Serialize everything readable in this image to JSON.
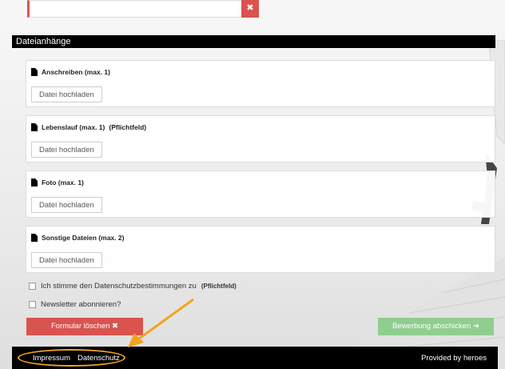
{
  "section": {
    "title": "Dateianhänge"
  },
  "attachments": [
    {
      "label": "Anschreiben (max. 1)",
      "button": "Datei hochladen"
    },
    {
      "label": "Lebenslauf (max. 1)",
      "required": "(Pflichtfeld)",
      "button": "Datei hochladen"
    },
    {
      "label": "Foto (max. 1)",
      "button": "Datei hochladen"
    },
    {
      "label": "Sonstige Dateien (max. 2)",
      "button": "Datei hochladen"
    }
  ],
  "consent": {
    "label": "Ich stimme den Datenschutzbestimmungen zu",
    "required": "(Pflichtfeld)"
  },
  "newsletter": {
    "label": "Newsletter abonnieren?"
  },
  "actions": {
    "clear_label": "Formular löschen ✖",
    "submit_label": "Bewerbung abschicken ➔"
  },
  "footer": {
    "impressum": "Impressum",
    "datenschutz": "Datenschutz",
    "provided_by": "Provided by heroes"
  },
  "colors": {
    "danger": "#d9534f",
    "success": "#8fce8f",
    "highlight": "#f2a41c"
  }
}
